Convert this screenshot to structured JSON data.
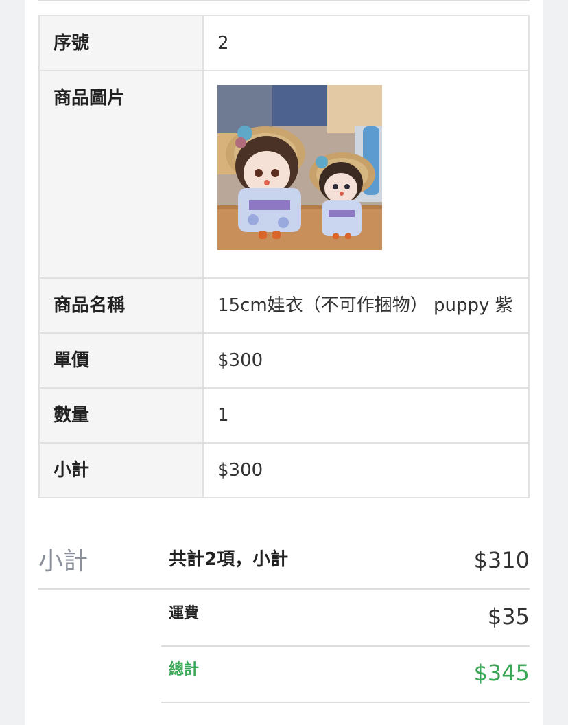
{
  "colors": {
    "background": "#f0f1f3",
    "card": "#ffffff",
    "label_cell": "#f5f5f5",
    "border": "#e1e1e1",
    "total_green": "#3aa757",
    "muted_title": "#8a8f99"
  },
  "item_table": {
    "rows": [
      {
        "label": "序號",
        "value": "2"
      },
      {
        "label": "商品圖片",
        "value": ""
      },
      {
        "label": "商品名稱",
        "value": "15cm娃衣（不可作捆物） puppy 紫"
      },
      {
        "label": "單價",
        "value": "$300"
      },
      {
        "label": "數量",
        "value": "1"
      },
      {
        "label": "小計",
        "value": "$300"
      }
    ],
    "product_image_icon": "doll-photo"
  },
  "summary": {
    "title": "小計",
    "subtotal_label": "共計2項，小計",
    "subtotal_value": "$310",
    "shipping_label": "運費",
    "shipping_value": "$35",
    "total_label": "總計",
    "total_value": "$345"
  }
}
